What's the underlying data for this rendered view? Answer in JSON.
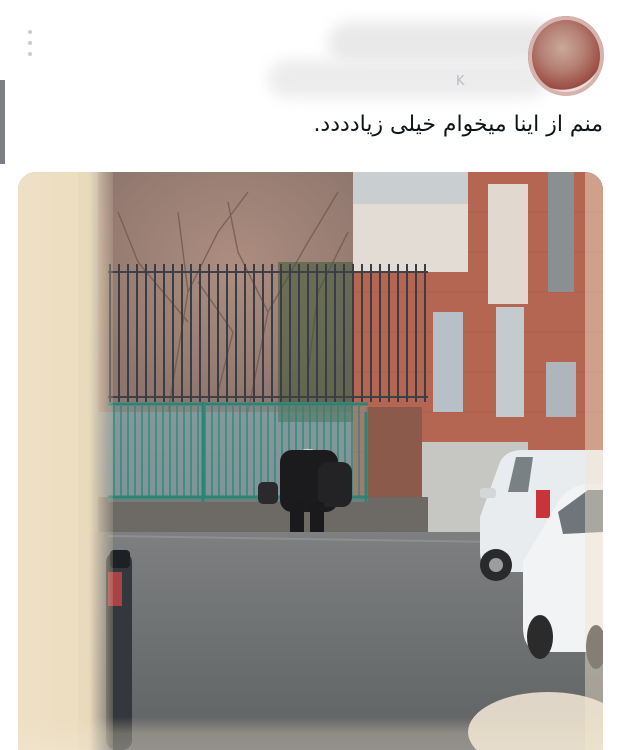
{
  "tweet": {
    "text": "منم از اینا میخوام خیلی زیادددد.",
    "handle_fragment": "K",
    "more_icon": "more-vertical-icon"
  },
  "colors": {
    "bezel": "#7c7f83",
    "text": "#0f1419",
    "fence": "#2a8578"
  }
}
